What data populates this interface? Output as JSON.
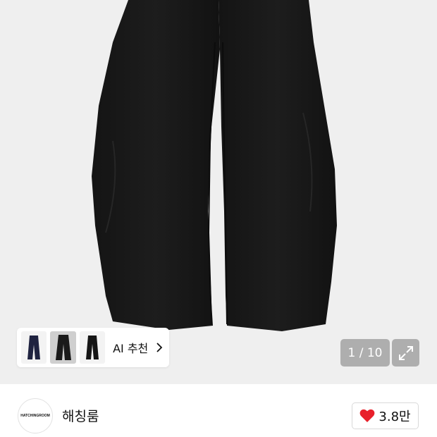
{
  "ai_recommend": {
    "label": "AI 추천",
    "thumbnails": [
      {
        "icon": "navy-pants-thumbnail",
        "color": "#1f2340"
      },
      {
        "icon": "black-pants-thumbnail",
        "color": "#1a1a1a"
      },
      {
        "icon": "black-pants-thumbnail",
        "color": "#151515"
      }
    ]
  },
  "gallery": {
    "counter": "1 / 10",
    "expand_icon": "expand-arrows-icon"
  },
  "brand": {
    "logo_text": "HATCHINGROOM",
    "name": "해칭룸"
  },
  "likes": {
    "icon": "heart-icon",
    "count": "3.8만",
    "color": "#e8202a"
  }
}
